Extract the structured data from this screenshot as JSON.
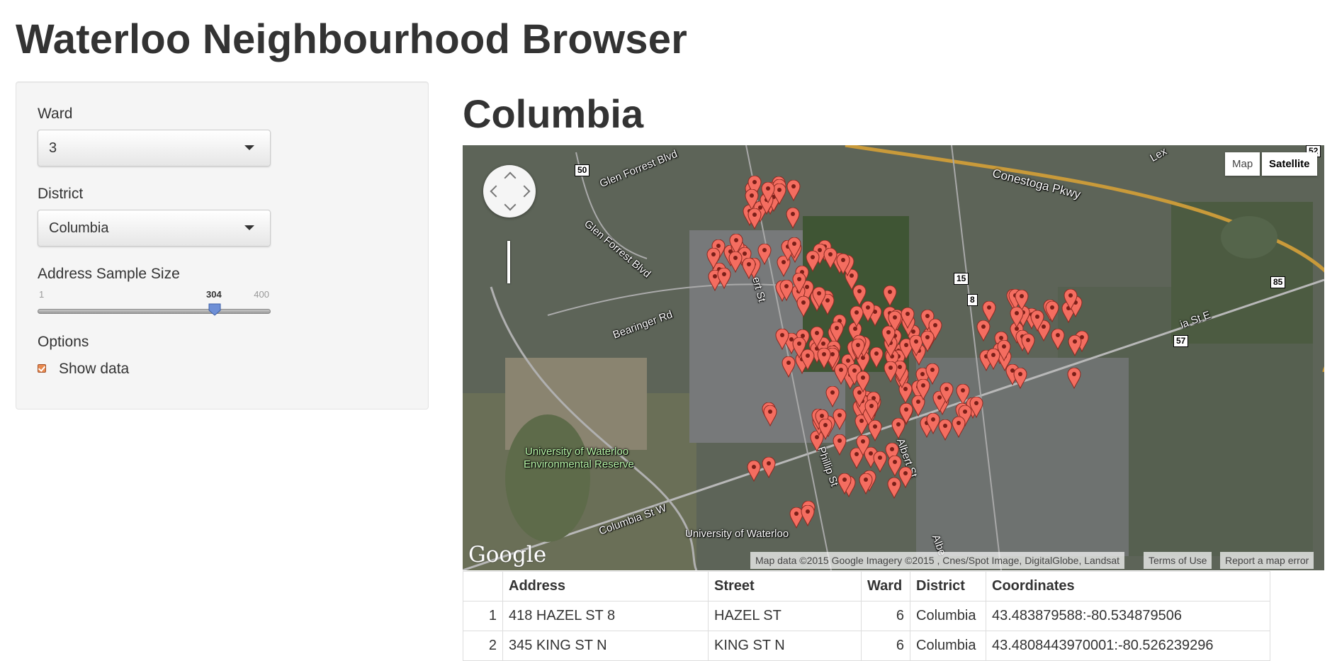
{
  "app": {
    "title": "Waterloo Neighbourhood Browser"
  },
  "sidebar": {
    "ward": {
      "label": "Ward",
      "value": "3"
    },
    "district": {
      "label": "District",
      "value": "Columbia"
    },
    "sample_size": {
      "label": "Address Sample Size",
      "min": "1",
      "max": "400",
      "value": "304",
      "fraction": 0.76
    },
    "options": {
      "label": "Options",
      "show_data": {
        "label": "Show data",
        "checked": true
      }
    }
  },
  "main": {
    "heading": "Columbia",
    "map": {
      "type_buttons": [
        "Map",
        "Satellite"
      ],
      "active_type": "Satellite",
      "logo": "Google",
      "attribution": "Map data ©2015 Google Imagery ©2015 , Cnes/Spot Image, DigitalGlobe, Landsat",
      "terms": "Terms of Use",
      "report": "Report a map error",
      "labels": {
        "glen_forrest_1": "Glen Forrest Blvd",
        "glen_forrest_2": "Glen Forrest Blvd",
        "bearinger": "Bearinger Rd",
        "conestoga": "Conestoga Pkwy",
        "columbia_w": "Columbia St W",
        "uw": "University of Waterloo",
        "reserve_1": "University of Waterloo",
        "reserve_2": "Environmental Reserve",
        "albert_st": "Albert St",
        "phillip": "Phillip St",
        "albert_st_2": "Albe",
        "lexington": "Lex",
        "columbia_e": "ia St E",
        "street_n": "ert St"
      },
      "shields": {
        "r50": "50",
        "r15": "15",
        "r8": "8",
        "r85": "85",
        "r57": "57",
        "r52": "52"
      },
      "pin_color": "#f46d60"
    },
    "table": {
      "headers": [
        "",
        "Address",
        "Street",
        "Ward",
        "District",
        "Coordinates"
      ],
      "rows": [
        [
          "1",
          "418 HAZEL ST 8",
          "HAZEL ST",
          "6",
          "Columbia",
          "43.483879588:-80.534879506"
        ],
        [
          "2",
          "345 KING ST N",
          "KING ST N",
          "6",
          "Columbia",
          "43.4808443970001:-80.526239296"
        ]
      ]
    }
  }
}
